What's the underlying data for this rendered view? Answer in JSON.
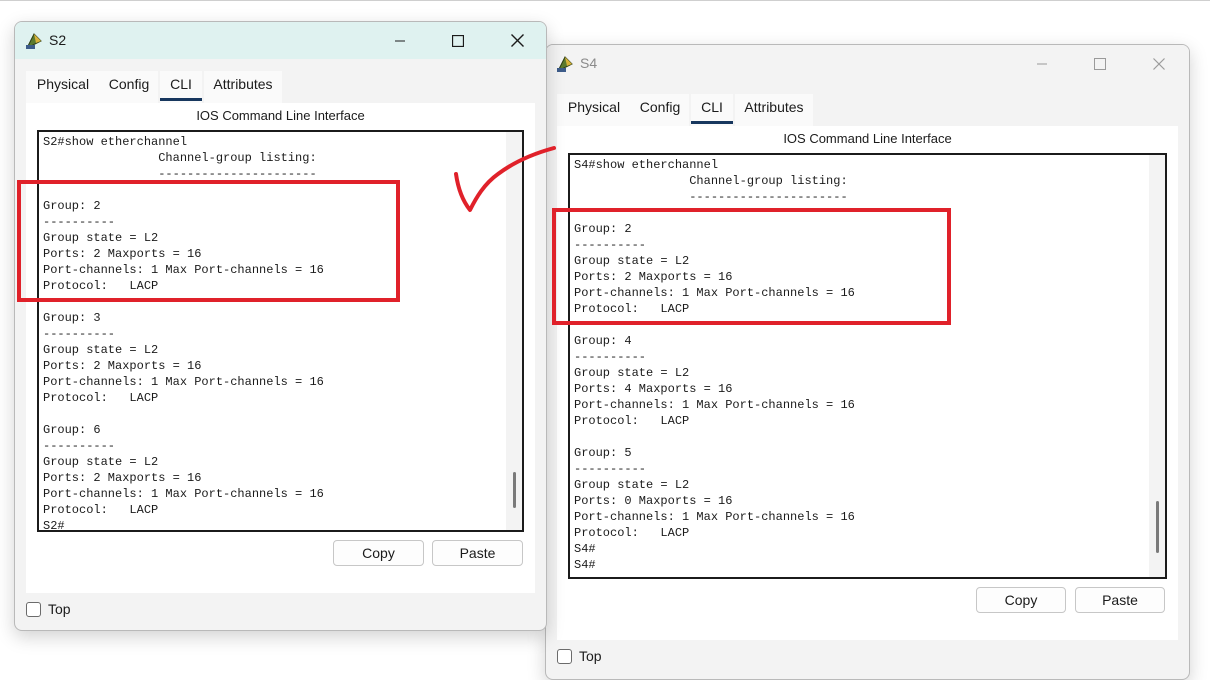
{
  "windows": [
    {
      "id": "s2",
      "title": "S2",
      "tabs": [
        "Physical",
        "Config",
        "CLI",
        "Attributes"
      ],
      "selected_tab": "CLI",
      "panel_header": "IOS Command Line Interface",
      "terminal_text": "S2#show etherchannel\n                Channel-group listing:\n                ----------------------\n\nGroup: 2\n----------\nGroup state = L2\nPorts: 2 Maxports = 16\nPort-channels: 1 Max Port-channels = 16\nProtocol:   LACP\n\nGroup: 3\n----------\nGroup state = L2\nPorts: 2 Maxports = 16\nPort-channels: 1 Max Port-channels = 16\nProtocol:   LACP\n\nGroup: 6\n----------\nGroup state = L2\nPorts: 2 Maxports = 16\nPort-channels: 1 Max Port-channels = 16\nProtocol:   LACP\nS2#",
      "copy_label": "Copy",
      "paste_label": "Paste",
      "top_label": "Top",
      "top_checked": false
    },
    {
      "id": "s4",
      "title": "S4",
      "tabs": [
        "Physical",
        "Config",
        "CLI",
        "Attributes"
      ],
      "selected_tab": "CLI",
      "panel_header": "IOS Command Line Interface",
      "terminal_text": "S4#show etherchannel\n                Channel-group listing:\n                ----------------------\n\nGroup: 2\n----------\nGroup state = L2\nPorts: 2 Maxports = 16\nPort-channels: 1 Max Port-channels = 16\nProtocol:   LACP\n\nGroup: 4\n----------\nGroup state = L2\nPorts: 4 Maxports = 16\nPort-channels: 1 Max Port-channels = 16\nProtocol:   LACP\n\nGroup: 5\n----------\nGroup state = L2\nPorts: 0 Maxports = 16\nPort-channels: 1 Max Port-channels = 16\nProtocol:   LACP\nS4#\nS4#",
      "copy_label": "Copy",
      "paste_label": "Paste",
      "top_label": "Top",
      "top_checked": false
    }
  ],
  "annotations": {
    "highlight_color": "#e0212a",
    "checkmark_icon": "checkmark-icon"
  },
  "colors": {
    "active_titlebar": "#dff2f0",
    "tab_underline": "#17375e"
  }
}
